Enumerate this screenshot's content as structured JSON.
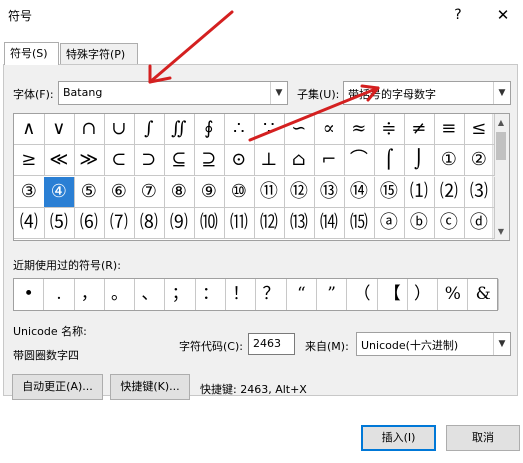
{
  "window": {
    "title": "符号",
    "help_glyph": "?",
    "close_glyph": "✕"
  },
  "tabs": [
    {
      "label": "符号(S)",
      "active": true
    },
    {
      "label": "特殊字符(P)",
      "active": false
    }
  ],
  "font": {
    "label": "字体(F):",
    "value": "Batang"
  },
  "subset": {
    "label": "子集(U):",
    "value": "带括号的字母数字"
  },
  "symbol_grid": {
    "rows": [
      [
        "∧",
        "∨",
        "∩",
        "∪",
        "∫",
        "∬",
        "∮",
        "∴",
        "∵",
        "∽",
        "∝",
        "≈",
        "≑",
        "≠",
        "≡",
        "≤"
      ],
      [
        "≥",
        "≪",
        "≫",
        "⊂",
        "⊃",
        "⊆",
        "⊇",
        "⊙",
        "⊥",
        "⌂",
        "⌐",
        "⌒",
        "⌠",
        "⌡",
        "①",
        "②"
      ],
      [
        "③",
        "④",
        "⑤",
        "⑥",
        "⑦",
        "⑧",
        "⑨",
        "⑩",
        "⑪",
        "⑫",
        "⑬",
        "⑭",
        "⑮",
        "⑴",
        "⑵",
        "⑶"
      ],
      [
        "⑷",
        "⑸",
        "⑹",
        "⑺",
        "⑻",
        "⑼",
        "⑽",
        "⑾",
        "⑿",
        "⒀",
        "⒁",
        "⒂",
        "ⓐ",
        "ⓑ",
        "ⓒ",
        "ⓓ"
      ]
    ],
    "selected": {
      "row": 2,
      "col": 1
    }
  },
  "recent": {
    "label": "近期使用过的符号(R):",
    "symbols": [
      "•",
      ".",
      "，",
      "。",
      "、",
      "；",
      "：",
      "！",
      "？",
      "“",
      "”",
      "（",
      "【",
      "）",
      "%",
      "&"
    ]
  },
  "unicode_name_label": "Unicode 名称:",
  "unicode_name_value": "带圆圈数字四",
  "char_code": {
    "label": "字符代码(C):",
    "value": "2463"
  },
  "from": {
    "label": "来自(M):",
    "value": "Unicode(十六进制)"
  },
  "buttons": {
    "autocorrect": "自动更正(A)...",
    "shortcut_key": "快捷键(K)...",
    "shortcut_text": "快捷键: 2463, Alt+X",
    "insert": "插入(I)",
    "cancel": "取消"
  },
  "colors": {
    "selection": "#2a7fd4",
    "annotation_arrow": "#d42020",
    "primary_border": "#0078d7"
  }
}
